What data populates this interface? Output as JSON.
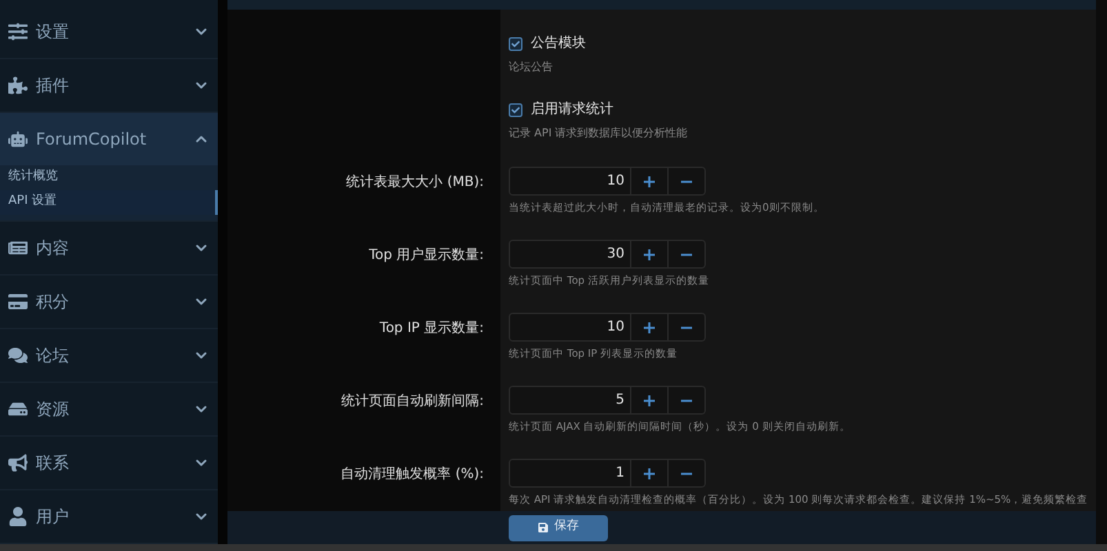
{
  "sidebar": {
    "items": [
      {
        "label": "设置",
        "expanded": false
      },
      {
        "label": "插件",
        "expanded": false
      },
      {
        "label": "ForumCopilot",
        "expanded": true,
        "children": [
          {
            "label": "统计概览",
            "selected": false
          },
          {
            "label": "API 设置",
            "selected": true
          }
        ]
      },
      {
        "label": "内容",
        "expanded": false
      },
      {
        "label": "积分",
        "expanded": false
      },
      {
        "label": "论坛",
        "expanded": false
      },
      {
        "label": "资源",
        "expanded": false
      },
      {
        "label": "联系",
        "expanded": false
      },
      {
        "label": "用户",
        "expanded": false
      }
    ]
  },
  "settings": [
    {
      "kind": "checkbox",
      "label": "公告模块",
      "checked": true,
      "description": "论坛公告"
    },
    {
      "kind": "checkbox",
      "label": "启用请求统计",
      "checked": true,
      "description": "记录 API 请求到数据库以便分析性能"
    },
    {
      "kind": "number",
      "label": "统计表最大大小 (MB):",
      "value": "10",
      "description": "当统计表超过此大小时，自动清理最老的记录。设为0则不限制。"
    },
    {
      "kind": "number",
      "label": "Top 用户显示数量:",
      "value": "30",
      "description": "统计页面中 Top 活跃用户列表显示的数量"
    },
    {
      "kind": "number",
      "label": "Top IP 显示数量:",
      "value": "10",
      "description": "统计页面中 Top IP 列表显示的数量"
    },
    {
      "kind": "number",
      "label": "统计页面自动刷新间隔:",
      "value": "5",
      "description": "统计页面 AJAX 自动刷新的间隔时间（秒）。设为 0 则关闭自动刷新。"
    },
    {
      "kind": "number",
      "label": "自动清理触发概率 (%):",
      "value": "1",
      "description": "每次 API 请求触发自动清理检查的概率（百分比）。设为 100 则每次请求都会检查。建议保持 1%~5%，避免频繁检查"
    }
  ],
  "save_button": {
    "label": "保存"
  }
}
